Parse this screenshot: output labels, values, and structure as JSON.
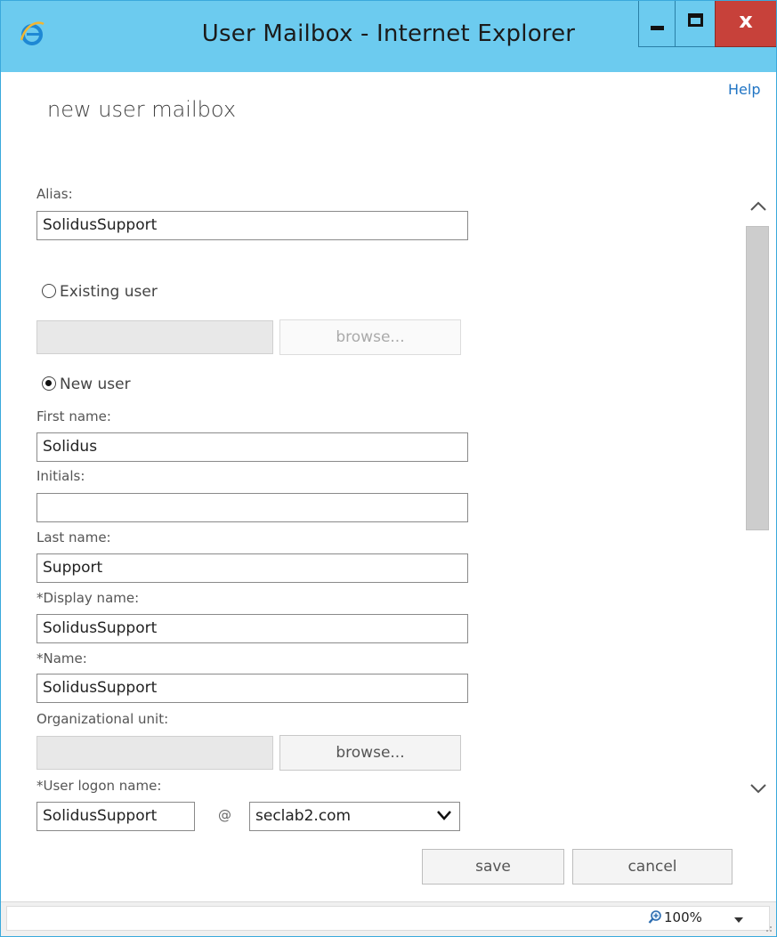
{
  "window": {
    "title": "User Mailbox - Internet Explorer",
    "minimize_glyph": "",
    "maximize_glyph": "",
    "close_glyph": "x"
  },
  "page": {
    "help_label": "Help",
    "title": "new user mailbox"
  },
  "form": {
    "alias_label": "Alias:",
    "alias_value": "SolidusSupport",
    "existing_user_label": "Existing user",
    "existing_user_value": "",
    "existing_browse_label": "browse...",
    "new_user_label": "New user",
    "first_name_label": "First name:",
    "first_name_value": "Solidus",
    "initials_label": "Initials:",
    "initials_value": "",
    "last_name_label": "Last name:",
    "last_name_value": "Support",
    "display_name_label": "*Display name:",
    "display_name_value": "SolidusSupport",
    "name_label": "*Name:",
    "name_value": "SolidusSupport",
    "ou_label": "Organizational unit:",
    "ou_value": "",
    "ou_browse_label": "browse...",
    "logon_label": "*User logon name:",
    "logon_value": "SolidusSupport",
    "at_symbol": "@",
    "domain_value": "seclab2.com",
    "selected_radio": "new_user"
  },
  "actions": {
    "save_label": "save",
    "cancel_label": "cancel"
  },
  "statusbar": {
    "zoom_label": "100%"
  },
  "colors": {
    "titlebar": "#6ccbef",
    "close_button": "#c7413a",
    "link": "#1f74c4"
  },
  "icons": {
    "browser": "ie-logo-icon",
    "zoom": "magnifier-icon",
    "dropdown": "chevron-down-icon",
    "scroll_up": "chevron-up-icon",
    "scroll_down": "chevron-down-icon"
  }
}
